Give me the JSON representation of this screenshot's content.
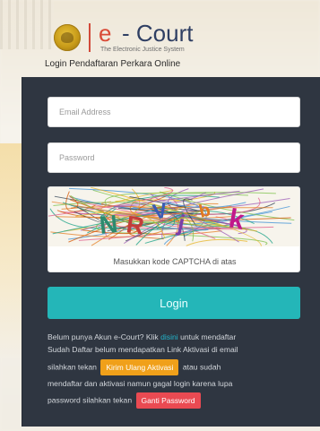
{
  "header": {
    "brand_prefix": "e",
    "brand_suffix": "- Court",
    "tagline": "The Electronic Justice System",
    "subtitle": "Login Pendaftaran Perkara Online"
  },
  "form": {
    "email_placeholder": "Email Address",
    "password_placeholder": "Password",
    "captcha_text": "NRVjbk",
    "captcha_hint": "Masukkan kode CAPTCHA di atas",
    "login_label": "Login"
  },
  "info": {
    "line1_pre": "Belum punya Akun e-Court? Klik ",
    "line1_link": "disini",
    "line1_post": " untuk mendaftar",
    "line2": "Sudah Daftar belum mendapatkan Link Aktivasi di email",
    "line3_pre": "silahkan tekan",
    "resend_button": "Kirim Ulang Aktivasi",
    "line3_post": "atau sudah",
    "line4": "mendaftar dan aktivasi namun gagal login karena lupa",
    "line5_pre": "password silahkan tekan",
    "change_password_button": "Ganti Password"
  },
  "colors": {
    "panel_bg": "#2f3641",
    "login_button": "#24b6b8",
    "resend_button": "#f0a01a",
    "change_password_button": "#ea4a52",
    "link": "#23b3c9",
    "brand_e": "#d94a36",
    "brand_court": "#2f3f63"
  },
  "icons": {
    "logo": "supreme-court-emblem-icon"
  }
}
